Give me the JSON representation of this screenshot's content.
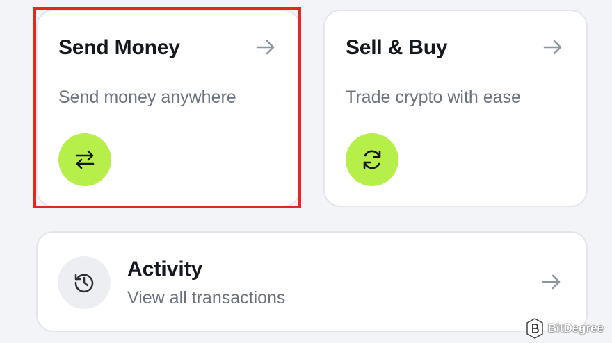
{
  "cards": [
    {
      "title": "Send Money",
      "subtitle": "Send money anywhere",
      "icon": "transfer-arrows-icon"
    },
    {
      "title": "Sell & Buy",
      "subtitle": "Trade crypto with ease",
      "icon": "refresh-icon"
    }
  ],
  "activity": {
    "title": "Activity",
    "subtitle": "View all transactions",
    "icon": "history-icon"
  },
  "watermark": {
    "text": "BitDegree"
  },
  "colors": {
    "accent": "#b7ef4a",
    "highlight": "#e02a1f",
    "background": "#f2f4f7",
    "card": "#ffffff",
    "title": "#15181e",
    "subtitle": "#6b7280",
    "arrow": "#8d95a3"
  }
}
